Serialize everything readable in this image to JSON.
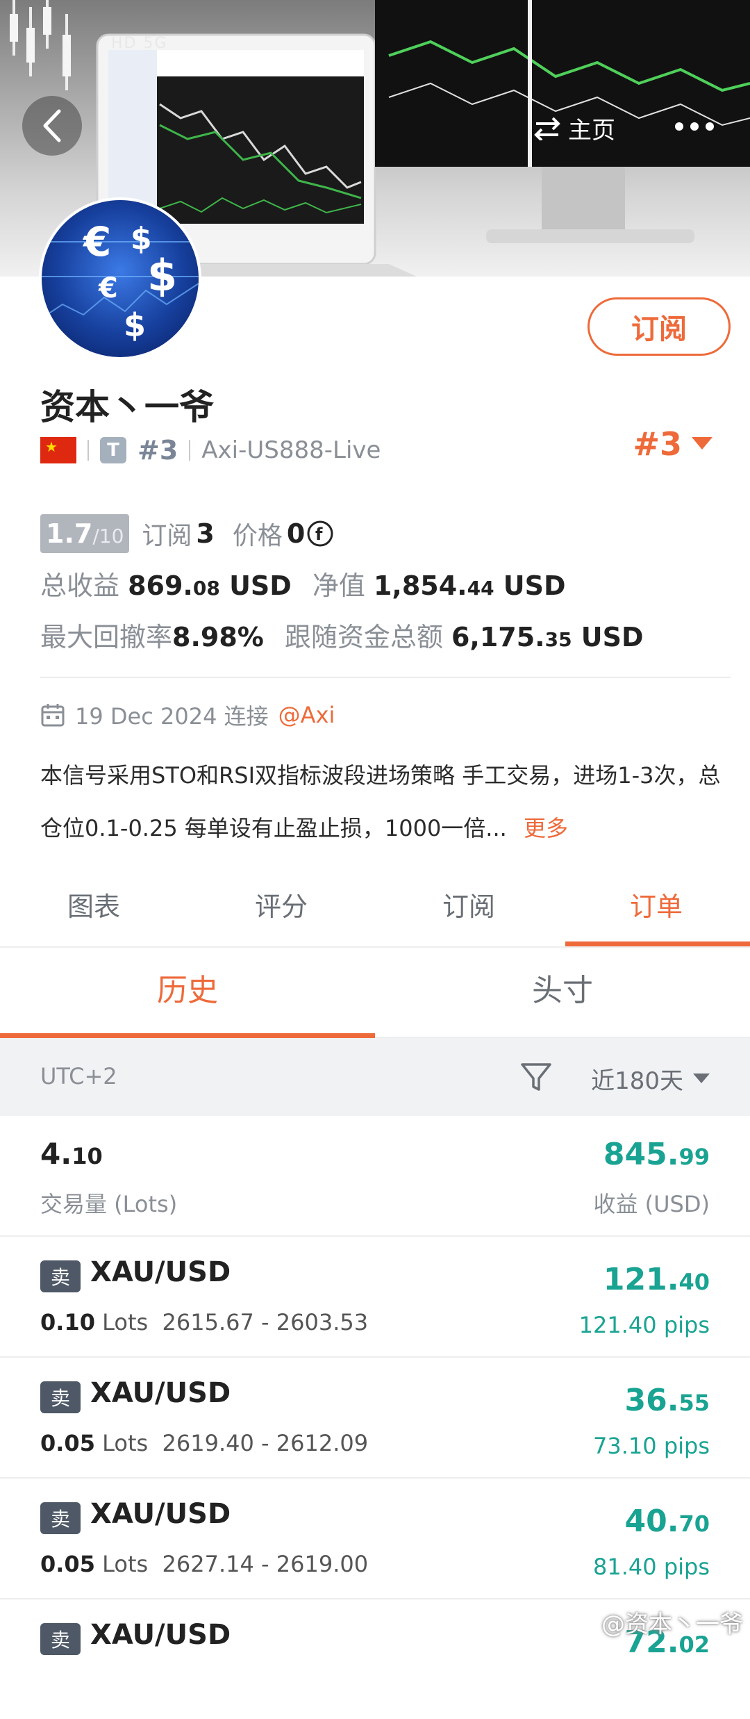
{
  "header": {
    "status_text": "HD 5G",
    "home_label": "主页"
  },
  "profile": {
    "subscribe_label": "订阅",
    "name": "资本丶一爷",
    "rank_small": "#3",
    "broker_server": "Axi-US888-Live",
    "rank_big": "#3",
    "t_badge": "T"
  },
  "stats": {
    "score_int": "1.7",
    "score_max": "/10",
    "subs_label": "订阅",
    "subs_value": "3",
    "price_label": "价格",
    "price_value": "0",
    "total_profit_label": "总收益",
    "total_profit_int": "869.",
    "total_profit_dec": "08",
    "total_profit_unit": " USD",
    "equity_label": "净值",
    "equity_int": "1,854.",
    "equity_dec": "44",
    "equity_unit": " USD",
    "drawdown_label": "最大回撤率",
    "drawdown_value": "8.98%",
    "follow_label": "跟随资金总额",
    "follow_int": "6,175.",
    "follow_dec": "35",
    "follow_unit": " USD"
  },
  "connection": {
    "date": "19 Dec 2024 连接",
    "broker_tag": "@Axi"
  },
  "description": {
    "text": "本信号采用STO和RSI双指标波段进场策略 手工交易，进场1-3次，总仓位0.1-0.25 每单设有止盈止损，1000一倍...",
    "more_label": "更多"
  },
  "tabs": [
    "图表",
    "评分",
    "订阅",
    "订单"
  ],
  "active_tab": "订单",
  "subtabs": [
    "历史",
    "头寸"
  ],
  "filter": {
    "timezone": "UTC+2",
    "range": "近180天"
  },
  "summary": {
    "lots_int": "4.",
    "lots_dec": "10",
    "lots_label": "交易量 (Lots)",
    "profit_int": "845.",
    "profit_dec": "99",
    "profit_label": "收益 (USD)"
  },
  "orders": [
    {
      "side": "卖",
      "symbol": "XAU/USD",
      "lots": "0.10",
      "lots_unit": " Lots",
      "prices": "2615.67 - 2603.53",
      "pnl_int": "121.",
      "pnl_dec": "40",
      "pips": "121.40 pips"
    },
    {
      "side": "卖",
      "symbol": "XAU/USD",
      "lots": "0.05",
      "lots_unit": " Lots",
      "prices": "2619.40 - 2612.09",
      "pnl_int": "36.",
      "pnl_dec": "55",
      "pips": "73.10 pips"
    },
    {
      "side": "卖",
      "symbol": "XAU/USD",
      "lots": "0.05",
      "lots_unit": " Lots",
      "prices": "2627.14 - 2619.00",
      "pnl_int": "40.",
      "pnl_dec": "70",
      "pips": "81.40 pips"
    },
    {
      "side": "卖",
      "symbol": "XAU/USD",
      "lots": "",
      "lots_unit": "",
      "prices": "",
      "pnl_int": "72.",
      "pnl_dec": "02",
      "pips": ""
    }
  ],
  "watermark": "@资本丶一爷",
  "colors": {
    "accent": "#ee6a3a",
    "profit": "#19a392",
    "badge": "#4e5867"
  }
}
